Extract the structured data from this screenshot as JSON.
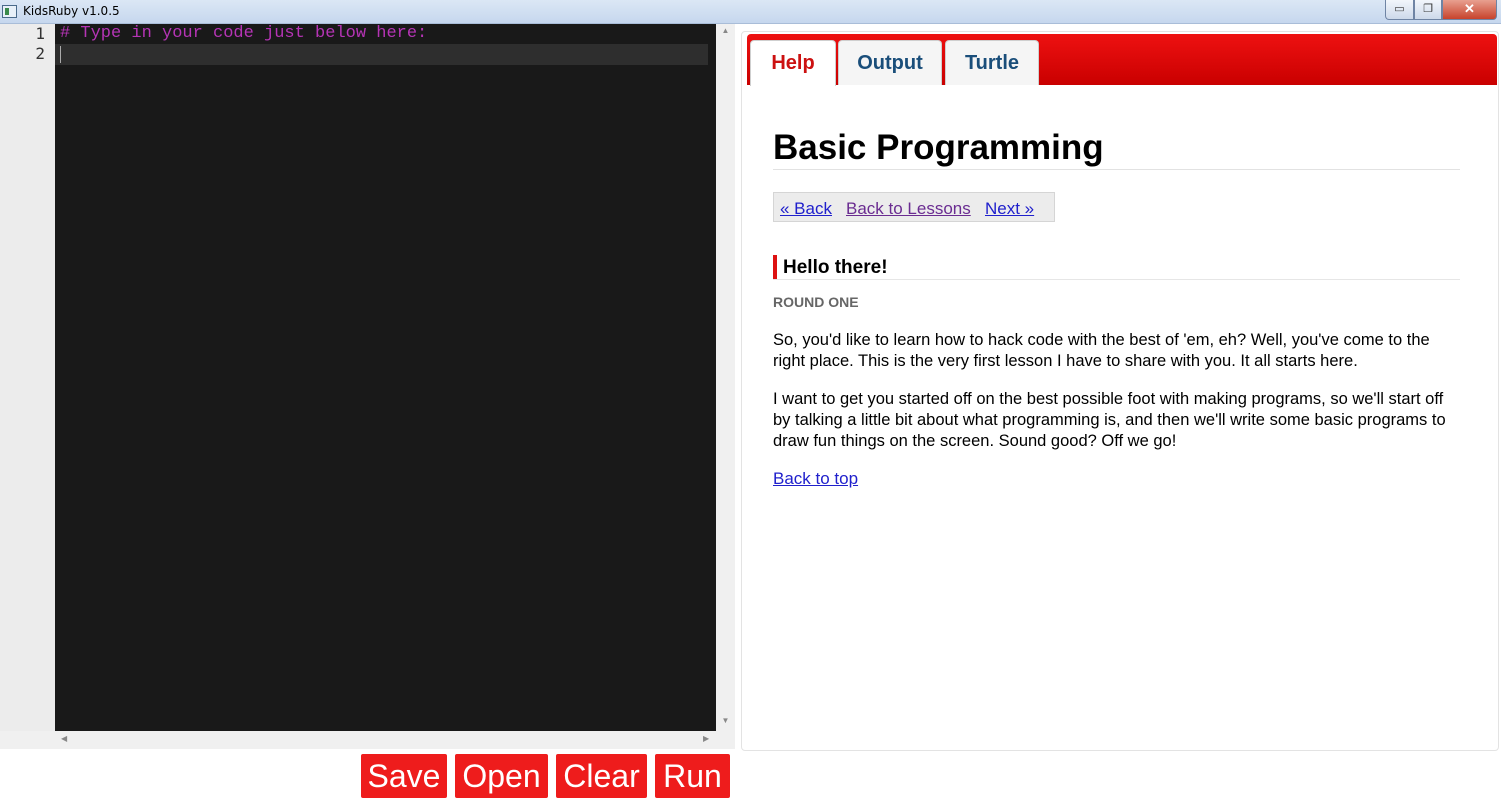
{
  "window": {
    "title": "KidsRuby v1.0.5",
    "min_glyph": "▭",
    "max_glyph": "❐",
    "close_glyph": "✕"
  },
  "editor": {
    "line_numbers": [
      "1",
      "2"
    ],
    "lines": [
      "# Type in your code just below here:",
      ""
    ],
    "scroll_up": "▲",
    "scroll_down": "▼",
    "scroll_left": "◀",
    "scroll_right": "▶"
  },
  "actions": {
    "save": "Save",
    "open": "Open",
    "clear": "Clear",
    "run": "Run"
  },
  "tabs": [
    {
      "label": "Help",
      "active": true
    },
    {
      "label": "Output",
      "active": false
    },
    {
      "label": "Turtle",
      "active": false
    }
  ],
  "help": {
    "title": "Basic Programming",
    "nav": {
      "back": "« Back",
      "lessons": "Back to Lessons",
      "next": "Next »"
    },
    "section_title": "Hello there!",
    "round": "ROUND ONE",
    "paragraphs": [
      "So, you'd like to learn how to hack code with the best of 'em, eh? Well, you've come to the right place. This is the very first lesson I have to share with you. It all starts here.",
      "I want to get you started off on the best possible foot with making programs, so we'll start off by talking a little bit about what programming is, and then we'll write some basic programs to draw fun things on the screen. Sound good? Off we go!"
    ],
    "back_to_top": "Back to top"
  },
  "colors": {
    "accent": "#ee1c1c",
    "editor_bg": "#191919",
    "comment": "#b534b5",
    "tab_text": "#1a4e7a"
  }
}
